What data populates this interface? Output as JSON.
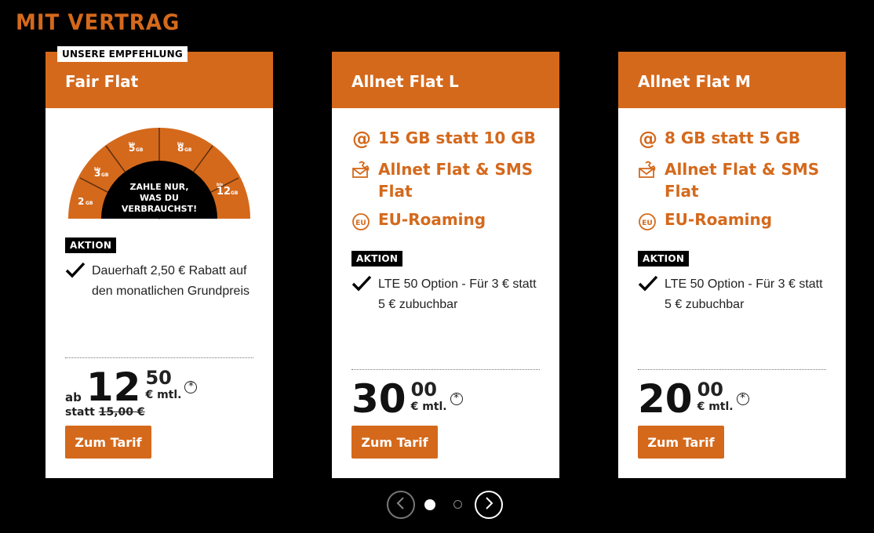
{
  "header": {
    "logo": "MIT VERTRAG"
  },
  "colors": {
    "accent": "#d4691c",
    "background": "#000000",
    "card": "#ffffff"
  },
  "cards": [
    {
      "badge": "UNSERE EMPFEHLUNG",
      "title": "Fair Flat",
      "meter": {
        "center_text_1": "ZAHLE NUR,",
        "center_text_2": "WAS DU",
        "center_text_3": "VERBRAUCHST!",
        "tiers": [
          {
            "prefix": "",
            "value": "2",
            "unit": "GB"
          },
          {
            "prefix": "bis",
            "value": "3",
            "unit": "GB"
          },
          {
            "prefix": "bis",
            "value": "5",
            "unit": "GB"
          },
          {
            "prefix": "bis",
            "value": "8",
            "unit": "GB"
          },
          {
            "prefix": "bis",
            "value": "12",
            "unit": "GB"
          }
        ]
      },
      "aktion_label": "AKTION",
      "aktion_text": "Dauerhaft 2,50 € Rabatt auf den monatlichen Grundpreis",
      "price_prefix": "ab",
      "price_euros": "12",
      "price_cents": "50",
      "price_unit": "€ mtl.",
      "price_mark": "*",
      "statt_label": "statt",
      "statt_value": "15,00 €",
      "button": "Zum Tarif"
    },
    {
      "title": "Allnet Flat L",
      "features": [
        {
          "icon": "at-icon",
          "text": "15 GB statt 10 GB"
        },
        {
          "icon": "phone-sms-icon",
          "text": "Allnet Flat & SMS Flat"
        },
        {
          "icon": "eu-icon",
          "text": "EU-Roaming"
        }
      ],
      "aktion_label": "AKTION",
      "aktion_text": "LTE 50 Option - Für 3 € statt 5 € zubuchbar",
      "price_euros": "30",
      "price_cents": "00",
      "price_unit": "€ mtl.",
      "price_mark": "*",
      "button": "Zum Tarif"
    },
    {
      "title": "Allnet Flat M",
      "features": [
        {
          "icon": "at-icon",
          "text": "8 GB statt 5 GB"
        },
        {
          "icon": "phone-sms-icon",
          "text": "Allnet Flat & SMS Flat"
        },
        {
          "icon": "eu-icon",
          "text": "EU-Roaming"
        }
      ],
      "aktion_label": "AKTION",
      "aktion_text": "LTE 50 Option - Für 3 € statt 5 € zubuchbar",
      "price_euros": "20",
      "price_cents": "00",
      "price_unit": "€ mtl.",
      "price_mark": "*",
      "button": "Zum Tarif"
    }
  ],
  "pagination": {
    "current_page": 1,
    "total_pages": 2
  }
}
